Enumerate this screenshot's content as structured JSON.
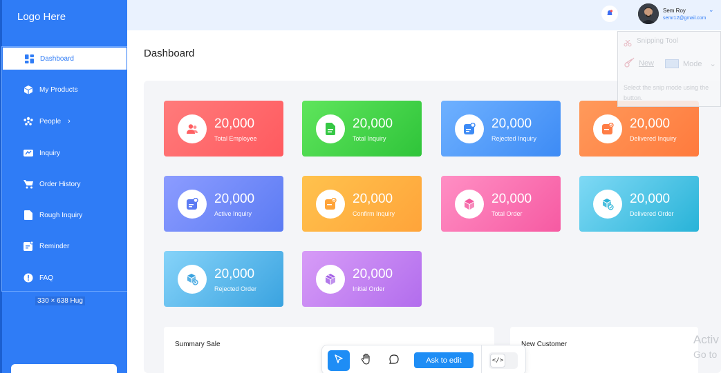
{
  "sidebar": {
    "logo": "Logo Here",
    "items": [
      {
        "label": "Dashboard",
        "icon": "grid-icon",
        "active": true
      },
      {
        "label": "My Products",
        "icon": "box-icon"
      },
      {
        "label": "People",
        "icon": "people-icon",
        "has_submenu": true
      },
      {
        "label": "Inquiry",
        "icon": "inquiry-icon"
      },
      {
        "label": "Order History",
        "icon": "cart-icon"
      },
      {
        "label": "Rough Inquiry",
        "icon": "document-icon"
      },
      {
        "label": "Reminder",
        "icon": "reminder-icon"
      },
      {
        "label": "FAQ",
        "icon": "info-icon"
      }
    ],
    "chevron": "›",
    "hug_tag": "330 × 638 Hug"
  },
  "header": {
    "user_name": "Sem Roy",
    "user_email": "semr12@gmail.com",
    "chevron": "⌄"
  },
  "main": {
    "title": "Dashboard",
    "cards": [
      {
        "value": "20,000",
        "label": "Total Employee",
        "icon": "users-icon",
        "color_from": "#ff7b7b",
        "color_to": "#ff5a5f",
        "icon_color": "#ff5f62"
      },
      {
        "value": "20,000",
        "label": "Total Inquiry",
        "icon": "file-icon",
        "color_from": "#5fe55c",
        "color_to": "#2fc43a",
        "icon_color": "#36c845"
      },
      {
        "value": "20,000",
        "label": "Rejected Inquiry",
        "icon": "rejected-inquiry-icon",
        "color_from": "#6fb1ff",
        "color_to": "#3d8bf5",
        "icon_color": "#3d8bf5"
      },
      {
        "value": "20,000",
        "label": "Delivered Inquiry",
        "icon": "delivered-inquiry-icon",
        "color_from": "#ff9a5b",
        "color_to": "#ff7a3d",
        "icon_color": "#ff7d45"
      },
      {
        "value": "20,000",
        "label": "Active Inquiry",
        "icon": "active-inquiry-icon",
        "color_from": "#8c9cff",
        "color_to": "#5b7bf3",
        "icon_color": "#5b7bf3"
      },
      {
        "value": "20,000",
        "label": "Confirm Inquiry",
        "icon": "confirm-inquiry-icon",
        "color_from": "#ffc24d",
        "color_to": "#ffa43a",
        "icon_color": "#ffa43a"
      },
      {
        "value": "20,000",
        "label": "Total Order",
        "icon": "cube-icon",
        "color_from": "#ff8fc4",
        "color_to": "#f65aa2",
        "icon_color": "#f45aa0"
      },
      {
        "value": "20,000",
        "label": "Delivered Order",
        "icon": "delivered-order-icon",
        "color_from": "#7fd9f5",
        "color_to": "#28b3d8",
        "icon_color": "#2db4d8"
      },
      {
        "value": "20,000",
        "label": "Rejected Order",
        "icon": "rejected-order-icon",
        "color_from": "#86d3f9",
        "color_to": "#3aa3e0",
        "icon_color": "#3aa3e0"
      },
      {
        "value": "20,000",
        "label": "Initial Order",
        "icon": "initial-order-icon",
        "color_from": "#d79cf7",
        "color_to": "#b26ded",
        "icon_color": "#a562e6"
      }
    ],
    "summary_title": "Summary Sale",
    "customer_title": "New Customer"
  },
  "snipping_tool": {
    "title": "Snipping Tool",
    "new_label": "New",
    "mode_label": "Mode",
    "hint": "Select the snip mode using the button."
  },
  "toolbar": {
    "ask_label": "Ask to edit",
    "code_label": "</>"
  },
  "watermark": {
    "line1": "Activ",
    "line2": "Go to"
  },
  "colors": {
    "sidebar": "#2f7cf6",
    "topbar": "#eaf2fe",
    "accent": "#1e8df5"
  }
}
